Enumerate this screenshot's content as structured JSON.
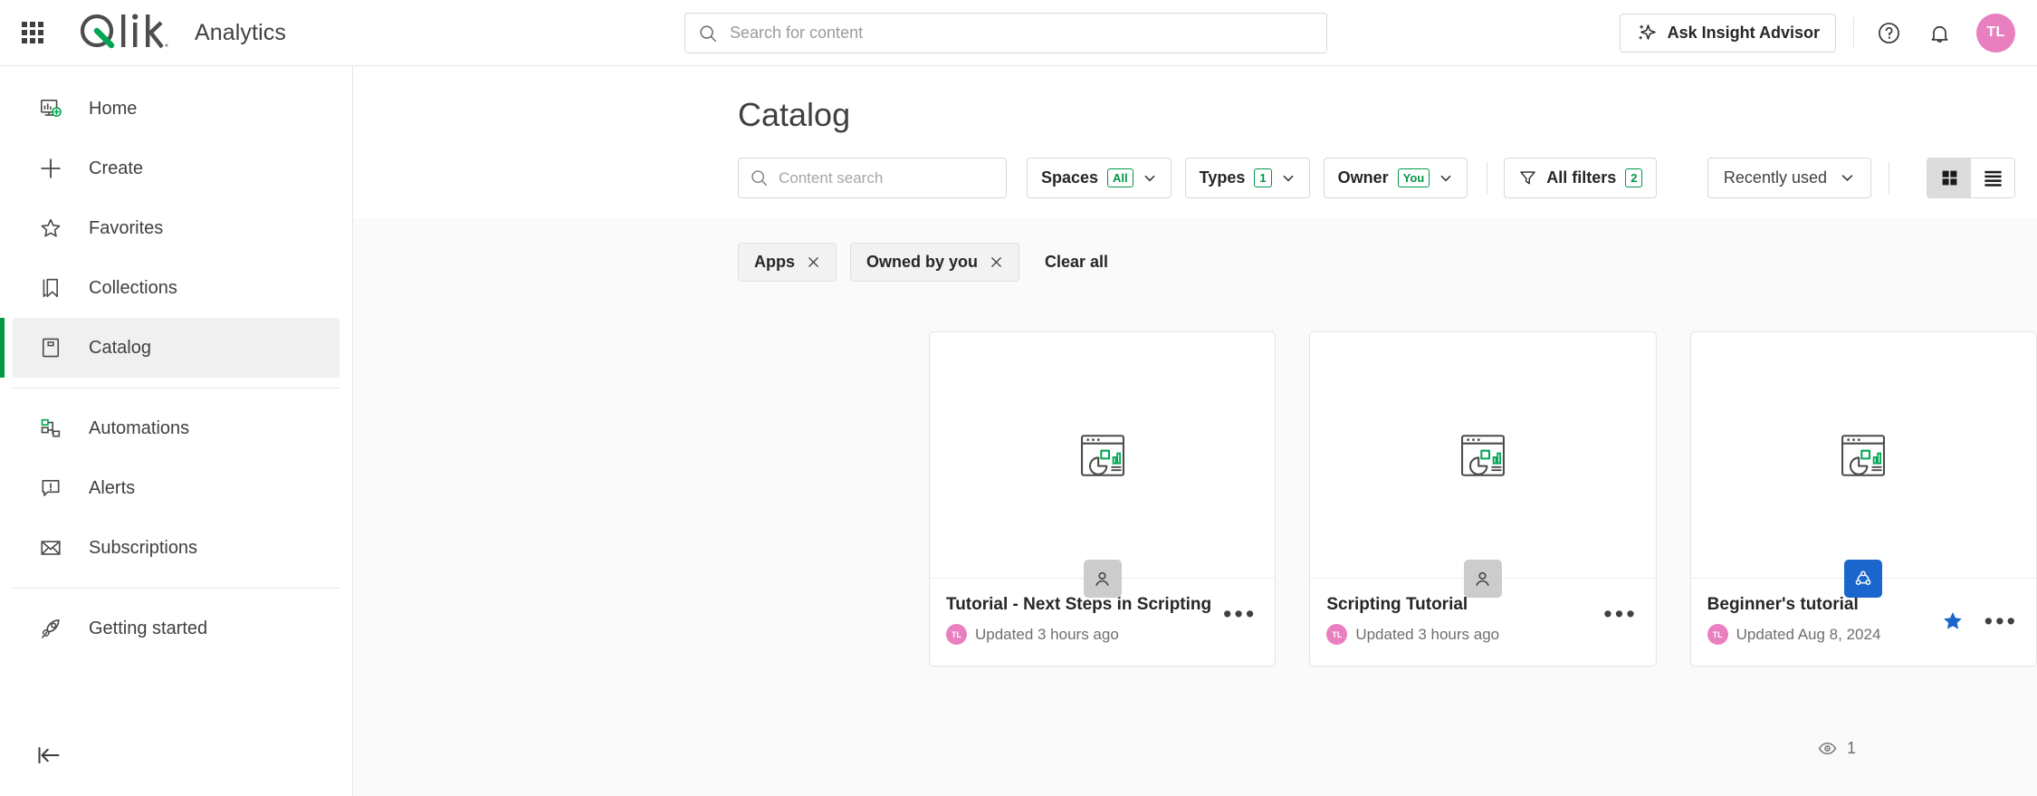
{
  "header": {
    "app_grid_icon": "app-grid-icon",
    "brand": "Qlik",
    "brand_sub": "Analytics",
    "search_placeholder": "Search for content",
    "search_value": "",
    "search_icon": "search-icon",
    "ask_insight_label": "Ask Insight Advisor",
    "ask_insight_icon": "sparkle-icon",
    "help_icon": "help-circle-icon",
    "notifications_icon": "bell-icon",
    "avatar_initials": "TL",
    "avatar_color": "#ea7fc0"
  },
  "sidebar": {
    "items": [
      {
        "label": "Home",
        "icon": "home-dashboard-icon",
        "active": false
      },
      {
        "label": "Create",
        "icon": "plus-icon",
        "active": false
      },
      {
        "label": "Favorites",
        "icon": "star-outline-icon",
        "active": false
      },
      {
        "label": "Collections",
        "icon": "bookmark-icon",
        "active": false
      },
      {
        "label": "Catalog",
        "icon": "catalog-book-icon",
        "active": true
      },
      {
        "label": "Automations",
        "icon": "automations-flow-icon",
        "active": false
      },
      {
        "label": "Alerts",
        "icon": "alert-bubble-icon",
        "active": false
      },
      {
        "label": "Subscriptions",
        "icon": "envelope-icon",
        "active": false
      },
      {
        "label": "Getting started",
        "icon": "rocket-icon",
        "active": false
      }
    ],
    "collapse_icon": "collapse-left-icon",
    "active_indicator_color": "#009845"
  },
  "main": {
    "page_title": "Catalog",
    "toolbar": {
      "content_search_placeholder": "Content search",
      "content_search_value": "",
      "search_icon": "search-icon",
      "filters": [
        {
          "label": "Spaces",
          "badge": "All",
          "icon": "chevron-down-icon"
        },
        {
          "label": "Types",
          "badge": "1",
          "icon": "chevron-down-icon"
        },
        {
          "label": "Owner",
          "badge": "You",
          "icon": "chevron-down-icon"
        }
      ],
      "all_filters": {
        "label": "All filters",
        "badge": "2",
        "icon": "funnel-icon"
      },
      "sort": {
        "label": "Recently used",
        "icon": "chevron-down-icon"
      },
      "view_grid": {
        "name": "grid-view",
        "active": true
      },
      "view_list": {
        "name": "list-view",
        "active": false
      },
      "badge_color": "#009845"
    },
    "chips": [
      {
        "label": "Apps",
        "remove_icon": "close-icon"
      },
      {
        "label": "Owned by you",
        "remove_icon": "close-icon"
      }
    ],
    "clear_all_label": "Clear all",
    "cards": [
      {
        "title": "Tutorial - Next Steps in Scripting",
        "updated": "Updated 3 hours ago",
        "owner_initials": "TL",
        "thumbnail_icon": "app-chart-window-icon",
        "space_badge_icon": "personal-space-icon",
        "space_badge_type": "personal",
        "favorited": false,
        "more_icon": "more-options-icon"
      },
      {
        "title": "Scripting Tutorial",
        "updated": "Updated 3 hours ago",
        "owner_initials": "TL",
        "thumbnail_icon": "app-chart-window-icon",
        "space_badge_icon": "personal-space-icon",
        "space_badge_type": "personal",
        "favorited": false,
        "more_icon": "more-options-icon"
      },
      {
        "title": "Beginner's tutorial",
        "updated": "Updated Aug 8, 2024",
        "owner_initials": "TL",
        "thumbnail_icon": "app-chart-window-icon",
        "space_badge_icon": "shared-space-icon",
        "space_badge_type": "shared",
        "favorited": true,
        "more_icon": "more-options-icon"
      }
    ],
    "view_count": {
      "icon": "eye-icon",
      "value": "1"
    }
  },
  "colors": {
    "qlik_green": "#009845",
    "favorite_blue": "#1a66cc",
    "shared_space_blue": "#1a66cc"
  }
}
